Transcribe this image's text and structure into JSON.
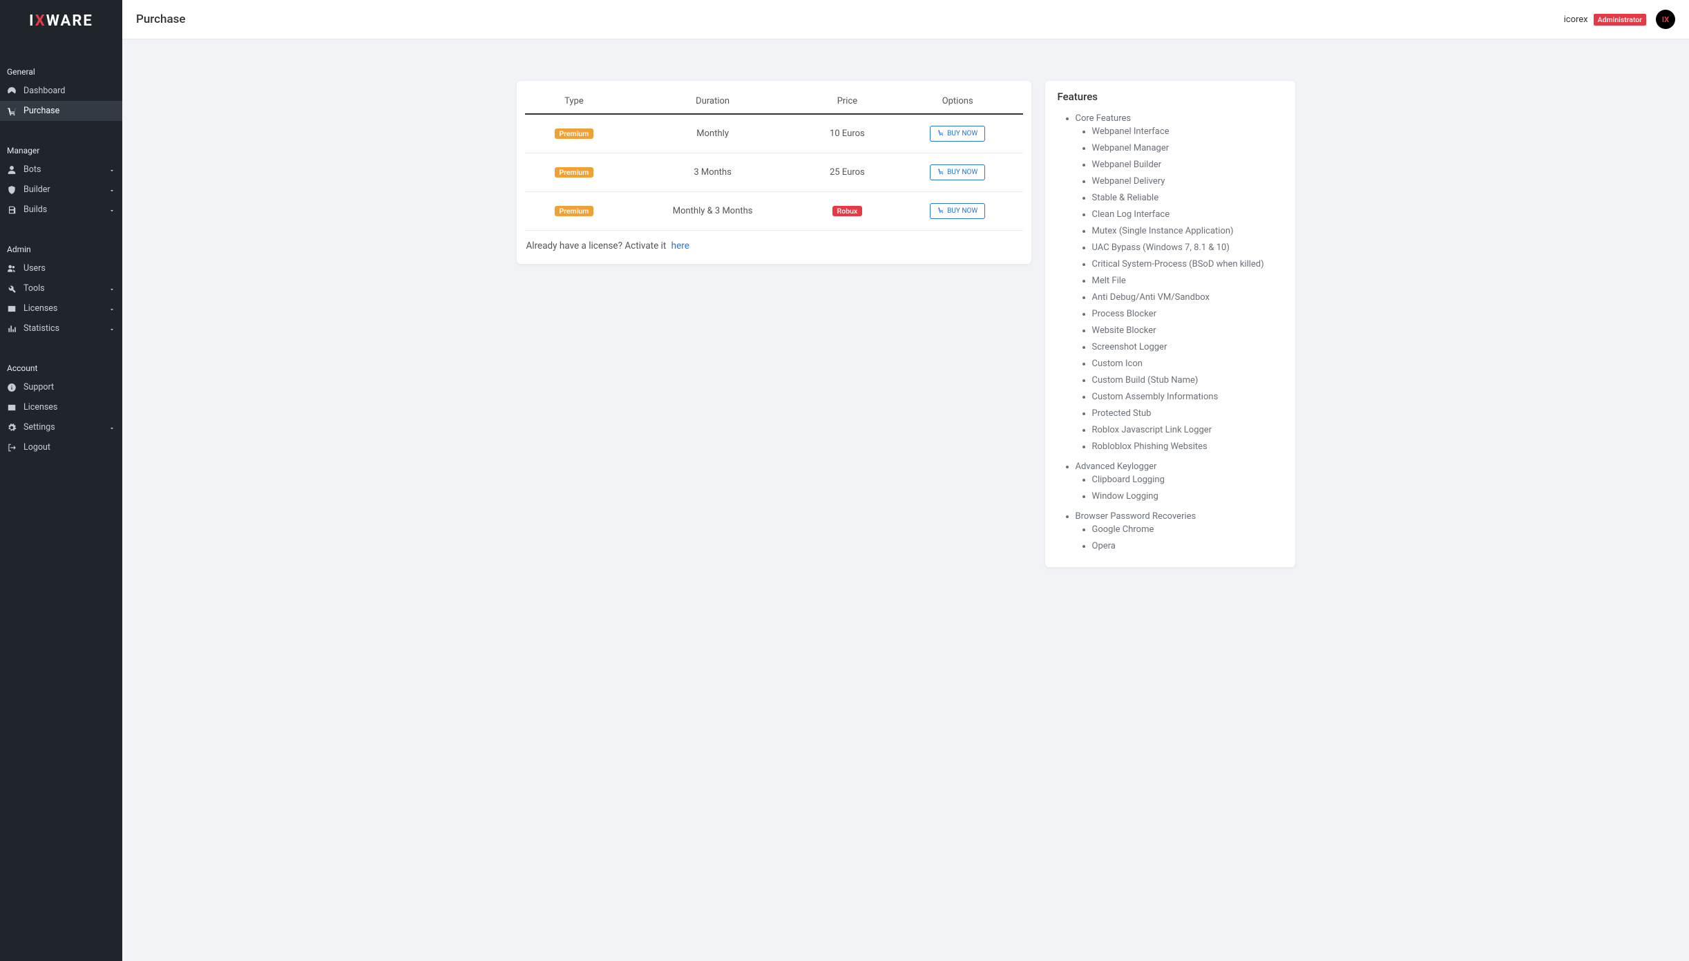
{
  "brand": {
    "prefix": "I",
    "x": "X",
    "suffix": "WARE"
  },
  "header": {
    "title": "Purchase",
    "username": "icorex",
    "role": "Administrator",
    "avatar_text": "IX"
  },
  "sidebar": {
    "sections": [
      {
        "header": "General",
        "items": [
          {
            "icon": "dashboard",
            "label": "Dashboard",
            "expandable": false,
            "active": false
          },
          {
            "icon": "cart",
            "label": "Purchase",
            "expandable": false,
            "active": true
          }
        ]
      },
      {
        "header": "Manager",
        "items": [
          {
            "icon": "user",
            "label": "Bots",
            "expandable": true,
            "active": false
          },
          {
            "icon": "shield",
            "label": "Builder",
            "expandable": true,
            "active": false
          },
          {
            "icon": "save",
            "label": "Builds",
            "expandable": true,
            "active": false
          }
        ]
      },
      {
        "header": "Admin",
        "items": [
          {
            "icon": "users",
            "label": "Users",
            "expandable": false,
            "active": false
          },
          {
            "icon": "tools",
            "label": "Tools",
            "expandable": true,
            "active": false
          },
          {
            "icon": "card",
            "label": "Licenses",
            "expandable": true,
            "active": false
          },
          {
            "icon": "chart",
            "label": "Statistics",
            "expandable": true,
            "active": false
          }
        ]
      },
      {
        "header": "Account",
        "items": [
          {
            "icon": "info",
            "label": "Support",
            "expandable": false,
            "active": false
          },
          {
            "icon": "card",
            "label": "Licenses",
            "expandable": false,
            "active": false
          },
          {
            "icon": "gear",
            "label": "Settings",
            "expandable": true,
            "active": false
          },
          {
            "icon": "logout",
            "label": "Logout",
            "expandable": false,
            "active": false
          }
        ]
      }
    ]
  },
  "table": {
    "headers": [
      "Type",
      "Duration",
      "Price",
      "Options"
    ],
    "rows": [
      {
        "type_badge": "Premium",
        "badge_class": "badge-premium",
        "duration": "Monthly",
        "price": "10 Euros",
        "price_badge": false,
        "buy_label": "BUY NOW"
      },
      {
        "type_badge": "Premium",
        "badge_class": "badge-premium",
        "duration": "3 Months",
        "price": "25 Euros",
        "price_badge": false,
        "buy_label": "BUY NOW"
      },
      {
        "type_badge": "Premium",
        "badge_class": "badge-premium",
        "duration": "Monthly & 3 Months",
        "price": "Robux",
        "price_badge": true,
        "buy_label": "BUY NOW"
      }
    ],
    "activate_text": "Already have a license? Activate it",
    "activate_link": "here"
  },
  "features": {
    "title": "Features",
    "groups": [
      {
        "label": "Core Features",
        "items": [
          "Webpanel Interface",
          "Webpanel Manager",
          "Webpanel Builder",
          "Webpanel Delivery",
          "Stable & Reliable",
          "Clean Log Interface",
          "Mutex (Single Instance Application)",
          "UAC Bypass (Windows 7, 8.1 & 10)",
          "Critical System-Process (BSoD when killed)",
          "Melt File",
          "Anti Debug/Anti VM/Sandbox",
          "Process Blocker",
          "Website Blocker",
          "Screenshot Logger",
          "Custom Icon",
          "Custom Build (Stub Name)",
          "Custom Assembly Informations",
          "Protected Stub",
          "Roblox Javascript Link Logger",
          "Robloblox Phishing Websites"
        ]
      },
      {
        "label": "Advanced Keylogger",
        "items": [
          "Clipboard Logging",
          "Window Logging"
        ]
      },
      {
        "label": "Browser Password Recoveries",
        "items": [
          "Google Chrome",
          "Opera"
        ]
      }
    ]
  }
}
